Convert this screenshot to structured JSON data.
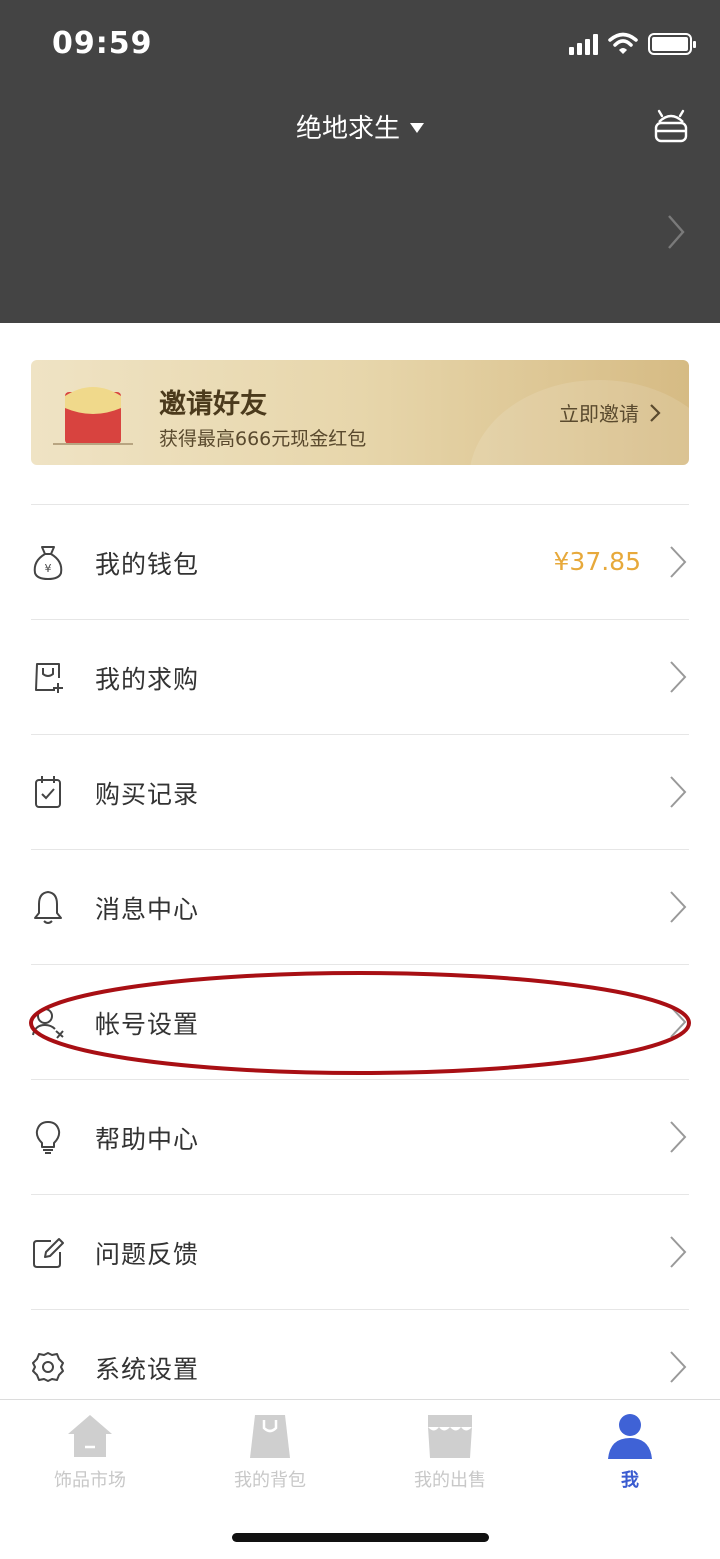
{
  "status_bar": {
    "time": "09:59"
  },
  "header": {
    "game_title": "绝地求生"
  },
  "invite": {
    "title": "邀请好友",
    "subtitle": "获得最高666元现金红包",
    "action": "立即邀请"
  },
  "menu": {
    "items": [
      {
        "label": "我的钱包",
        "value": "¥37.85",
        "icon": "wallet-icon"
      },
      {
        "label": "我的求购",
        "icon": "purchase-request-icon"
      },
      {
        "label": "购买记录",
        "icon": "purchase-history-icon"
      },
      {
        "label": "消息中心",
        "icon": "bell-icon"
      },
      {
        "label": "帐号设置",
        "icon": "account-icon"
      },
      {
        "label": "帮助中心",
        "icon": "lightbulb-icon"
      },
      {
        "label": "问题反馈",
        "icon": "edit-icon"
      },
      {
        "label": "系统设置",
        "icon": "gear-icon"
      }
    ]
  },
  "tabbar": {
    "tabs": [
      {
        "label": "饰品市场",
        "icon": "house-icon"
      },
      {
        "label": "我的背包",
        "icon": "bag-icon"
      },
      {
        "label": "我的出售",
        "icon": "shop-icon"
      },
      {
        "label": "我",
        "icon": "person-icon",
        "active": true
      }
    ]
  },
  "colors": {
    "header_bg": "#444444",
    "accent_price": "#e7a93b",
    "tab_active": "#3a5bd0",
    "annotation": "#a80f14"
  }
}
